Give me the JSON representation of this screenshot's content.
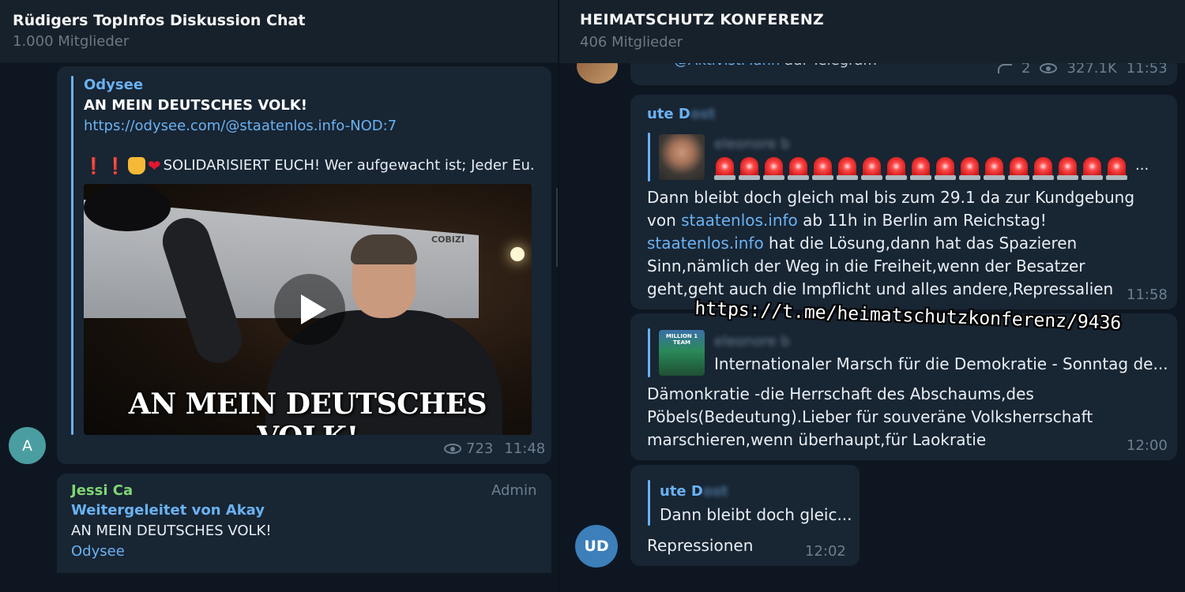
{
  "left_chat": {
    "title": "Rüdigers TopInfos Diskussion Chat",
    "members": "1.000 Mitglieder",
    "post": {
      "link_site": "Odysee",
      "link_title": "AN MEIN DEUTSCHES VOLK!",
      "link_url": "https://odysee.com/@staatenlos.info-NOD:7",
      "description": "SOLIDARISIERT EUCH! Wer aufgewacht ist; Jeder Eu...",
      "video_caption": "AN MEIN DEUTSCHES VOLK!",
      "video_tent_text": "COBIZI",
      "views": "723",
      "time": "11:48",
      "avatar_letter": "A"
    },
    "reply": {
      "author": "Jessi Ca",
      "role": "Admin",
      "forwarded_from": "Weitergeleitet von Akay",
      "text": "AN MEIN DEUTSCHES VOLK!",
      "site": "Odysee"
    }
  },
  "right_chat": {
    "title": "HEIMATSCHUTZ KONFERENZ",
    "members": "406 Mitglieder",
    "top_message": {
      "mention": "@AktivistMann",
      "suffix": " auf Telegram",
      "replies": "2",
      "views": "327.1K",
      "time": "11:53"
    },
    "message_a": {
      "author": "ute D",
      "author_blurred": "ost",
      "quoted_name": "eleonore b",
      "siren_count": 17,
      "text_1": "Dann bleibt doch gleich mal bis zum 29.1 da zur Kundgebung von ",
      "link_1": "staatenlos.info",
      "text_2": " ab 11h in Berlin am Reichstag! ",
      "link_2": "staatenlos.info",
      "text_3": " hat die Lösung,dann hat das Spazieren Sinn,nämlich der Weg in die Freiheit,wenn der Besatzer geht,geht auch die Impflicht und alles andere,Repressalien",
      "time": "11:58"
    },
    "message_b": {
      "quoted_name": "eleonore b",
      "thumb_text": "MILLION 1 TEAM",
      "quoted_text": "Internationaler Marsch für die Demokratie - Sonntag de...",
      "text": "Dämonkratie -die Herrschaft des Abschaums,des Pöbels(Bedeutung).Lieber für souveräne Volksherrschaft marschieren,wenn überhaupt,für Laokratie",
      "time": "12:00"
    },
    "message_c": {
      "quoted_author": "ute D",
      "quoted_author_blurred": "ost",
      "quoted_text": "Dann bleibt doch gleic...",
      "text": "Repressionen",
      "time": "12:02",
      "avatar_initials": "UD"
    }
  },
  "overlay_url": "https://t.me/heimatschutzkonferenz/9436",
  "colors": {
    "background": "#0e1621",
    "header": "#17212b",
    "bubble": "#182533",
    "accent_blue": "#6ab2f2",
    "admin_green": "#7fd674",
    "muted": "#6d7f8f"
  }
}
